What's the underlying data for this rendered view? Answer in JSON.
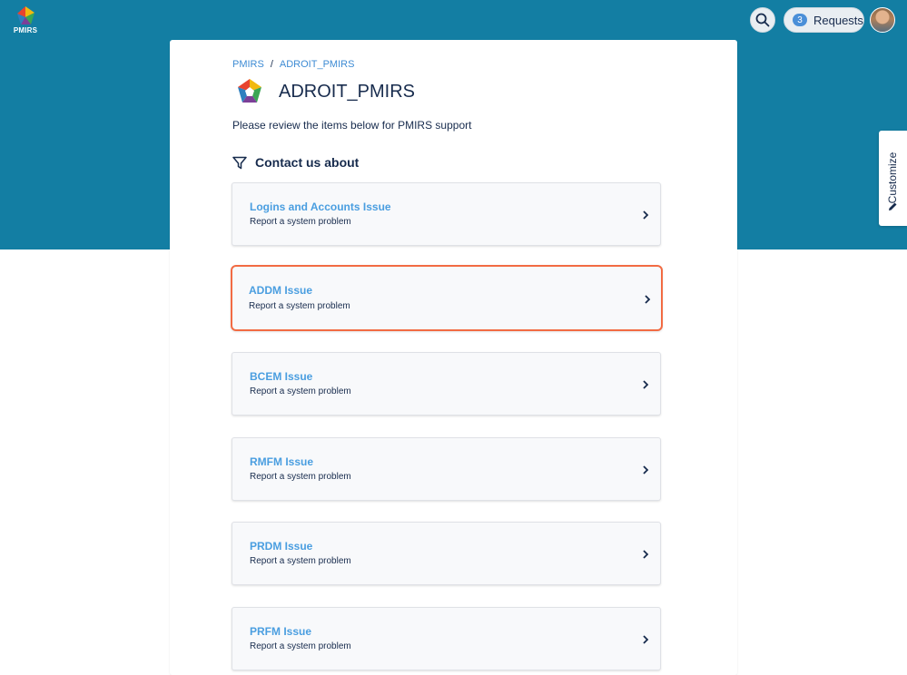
{
  "header": {
    "logo_text": "PMIRS",
    "requests_count": "3",
    "requests_label": "Requests",
    "icons": [
      "search-icon",
      "avatar"
    ]
  },
  "customize_label": "Customize",
  "breadcrumb": [
    "PMIRS",
    "ADROIT_PMIRS"
  ],
  "breadcrumb_separator": "/",
  "project_title": "ADROIT_PMIRS",
  "intro": "Please review the items below for PMIRS support",
  "section_title": "Contact us about",
  "items": [
    {
      "title": "Logins and Accounts Issue",
      "subtitle": "Report a system problem"
    },
    {
      "title": "ADDM Issue",
      "subtitle": "Report a system problem"
    },
    {
      "title": "BCEM Issue",
      "subtitle": "Report a system problem"
    },
    {
      "title": "RMFM Issue",
      "subtitle": "Report a system problem"
    },
    {
      "title": "PRDM Issue",
      "subtitle": "Report a system problem"
    },
    {
      "title": "PRFM Issue",
      "subtitle": "Report a system problem"
    }
  ],
  "colors": {
    "banner": "#137ea3",
    "link": "#3d8bd4",
    "item_title": "#4a9ee0",
    "focus_border": "#f26b43"
  }
}
